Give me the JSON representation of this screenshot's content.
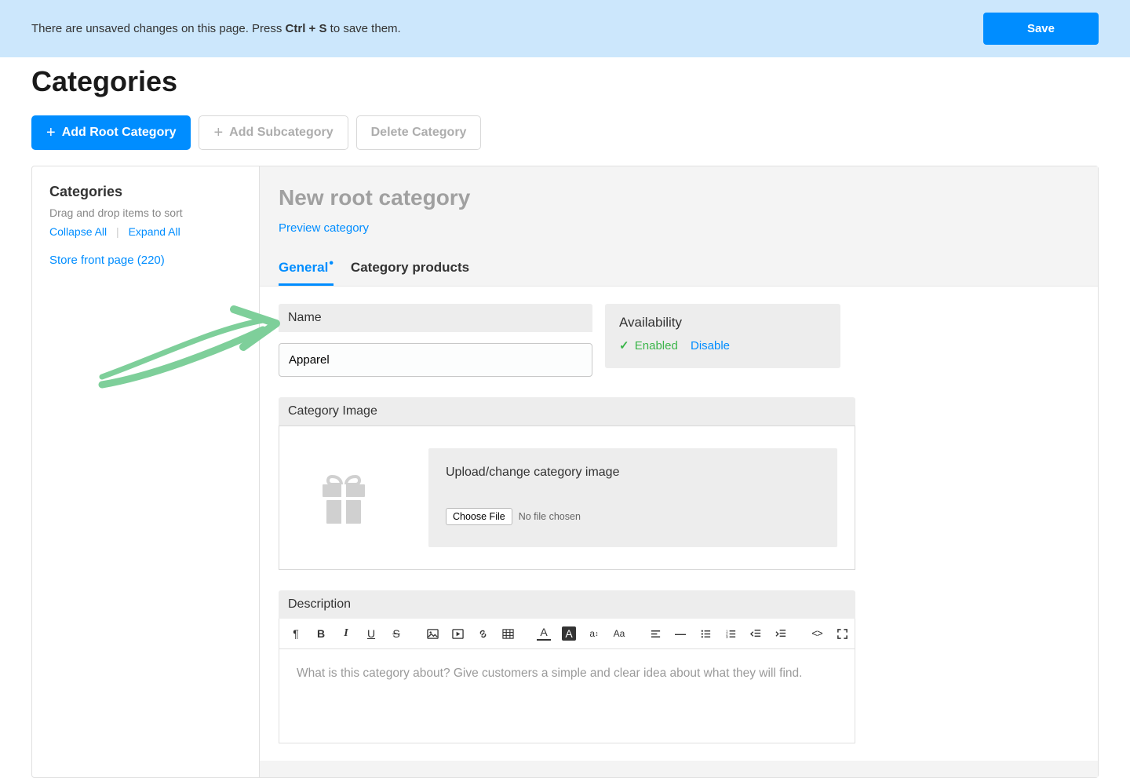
{
  "banner": {
    "text_before": "There are unsaved changes on this page. Press ",
    "shortcut": "Ctrl + S",
    "text_after": " to save them.",
    "save_label": "Save"
  },
  "page_title": "Categories",
  "actions": {
    "add_root": "Add Root Category",
    "add_sub": "Add Subcategory",
    "delete": "Delete Category"
  },
  "sidebar": {
    "title": "Categories",
    "hint": "Drag and drop items to sort",
    "collapse": "Collapse All",
    "expand": "Expand All",
    "store_front": "Store front page (220)"
  },
  "content": {
    "title": "New root category",
    "preview": "Preview category",
    "tabs": {
      "general": "General",
      "products": "Category products"
    }
  },
  "form": {
    "name_label": "Name",
    "name_value": "Apparel",
    "availability_label": "Availability",
    "enabled": "Enabled",
    "disable": "Disable",
    "image_label": "Category Image",
    "upload_title": "Upload/change category image",
    "choose_file": "Choose File",
    "no_file": "No file chosen",
    "description_label": "Description",
    "description_placeholder": "What is this category about? Give customers a simple and clear idea about what they will find."
  },
  "editor_icons": {
    "para": "¶",
    "bold": "B",
    "italic": "I",
    "underline": "U",
    "strike": "S",
    "image": "image",
    "video": "video",
    "link": "link",
    "table": "table",
    "textcolor": "A",
    "bgcolor": "A",
    "size": "a↕",
    "case": "Aa",
    "align": "align",
    "hr": "—",
    "ul": "ul",
    "ol": "ol",
    "indent_out": "out",
    "indent_in": "in",
    "code": "<>",
    "full": "full"
  }
}
